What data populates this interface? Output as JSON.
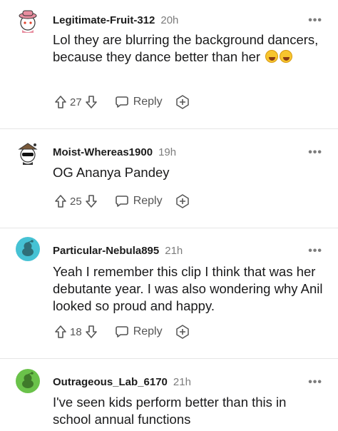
{
  "comments": [
    {
      "username": "Legitimate-Fruit-312",
      "time": "20h",
      "text": "Lol they are blurring the background dancers, because they dance better than her",
      "emojis": [
        "rolling-on-floor-laughing-emoji",
        "rolling-on-floor-laughing-emoji"
      ],
      "votes": "27",
      "reply_label": "Reply",
      "avatar": "snoo-avatar-pink-hat"
    },
    {
      "username": "Moist-Whereas1900",
      "time": "19h",
      "text": "OG Ananya Pandey",
      "votes": "25",
      "reply_label": "Reply",
      "avatar": "snoo-avatar-sunglasses"
    },
    {
      "username": "Particular-Nebula895",
      "time": "21h",
      "text": "Yeah I remember this clip I think that was her debutante year. I was also wondering why Anil looked so proud and happy.",
      "votes": "18",
      "reply_label": "Reply",
      "avatar": "default-avatar-teal"
    },
    {
      "username": "Outrageous_Lab_6170",
      "time": "21h",
      "text": "I've seen kids perform better than this in school annual functions",
      "avatar": "default-avatar-green"
    }
  ],
  "more_label": "•••",
  "colors": {
    "teal": "#46c2d4",
    "green": "#6ac24a",
    "muted": "#7c7c7c"
  }
}
